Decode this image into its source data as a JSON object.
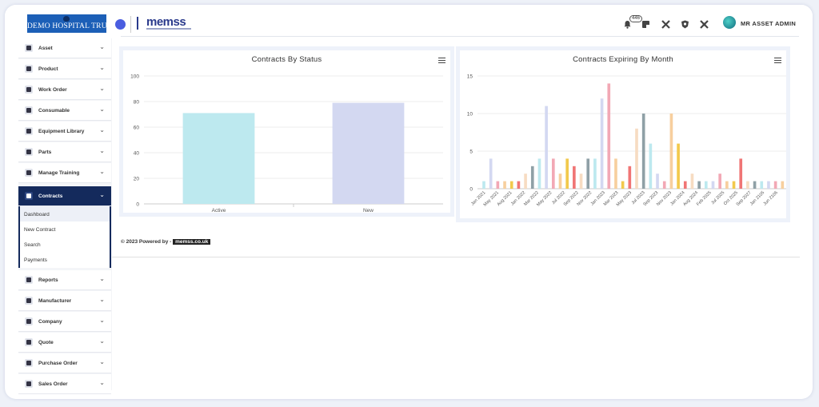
{
  "header": {
    "brand": "DEMO HOSPITAL TRUST",
    "logo_text": "memss",
    "notification_count": "446",
    "user_name": "MR ASSET ADMIN",
    "icons": [
      "bell-icon",
      "note-icon",
      "tools-icon",
      "shield-icon",
      "wrench-icon"
    ]
  },
  "sidebar": {
    "items": [
      {
        "label": "Asset",
        "icon": "asset-icon"
      },
      {
        "label": "Product",
        "icon": "product-icon"
      },
      {
        "label": "Work Order",
        "icon": "work-order-icon"
      },
      {
        "label": "Consumable",
        "icon": "consumable-icon"
      },
      {
        "label": "Equipment Library",
        "icon": "library-icon"
      },
      {
        "label": "Parts",
        "icon": "parts-icon"
      },
      {
        "label": "Manage Training",
        "icon": "training-icon"
      },
      {
        "label": "Contracts",
        "icon": "eye-icon",
        "active": true
      },
      {
        "label": "Reports",
        "icon": "reports-icon"
      },
      {
        "label": "Manufacturer",
        "icon": "factory-icon"
      },
      {
        "label": "Company",
        "icon": "company-icon"
      },
      {
        "label": "Quote",
        "icon": "quote-icon"
      },
      {
        "label": "Purchase Order",
        "icon": "purchase-icon"
      },
      {
        "label": "Sales Order",
        "icon": "sales-icon"
      }
    ],
    "contracts_sub": [
      "Dashboard",
      "New Contract",
      "Search",
      "Payments"
    ]
  },
  "footer": {
    "text": "© 2023 Powered by - ",
    "link": "memss.co.uk"
  },
  "chart_data": [
    {
      "type": "bar",
      "title": "Contracts By Status",
      "categories": [
        "Active",
        "New"
      ],
      "values": [
        71,
        79
      ],
      "colors": [
        "#bde9ef",
        "#d3d8f1"
      ],
      "ylim": [
        0,
        100
      ],
      "yticks": [
        0,
        20,
        40,
        60,
        80,
        100
      ]
    },
    {
      "type": "bar",
      "title": "Contracts Expiring By Month",
      "ylim": [
        0,
        15
      ],
      "yticks": [
        0,
        5,
        10,
        15
      ],
      "tick_labels": [
        "Jan 2021",
        "May 2021",
        "Aug 2021",
        "Jan 2022",
        "Mar 2022",
        "May 2022",
        "Jul 2022",
        "Sep 2022",
        "Nov 2022",
        "Jan 2023",
        "Mar 2023",
        "May 2023",
        "Jul 2023",
        "Sep 2023",
        "Nov 2023",
        "Jan 2024",
        "Aug 2024",
        "Feb 2025",
        "Jul 2025",
        "Oct 2025",
        "Sep 2027",
        "Jan 2105",
        "Jun 2106"
      ],
      "values": [
        1,
        4,
        1,
        1,
        1,
        1,
        2,
        3,
        4,
        11,
        4,
        2,
        4,
        3,
        2,
        4,
        4,
        12,
        14,
        4,
        1,
        3,
        8,
        10,
        6,
        2,
        1,
        10,
        6,
        1,
        2,
        1,
        1,
        1,
        2,
        1,
        1,
        4,
        1,
        1,
        1,
        1,
        1,
        1
      ],
      "colors": [
        "#bde9ef",
        "#d3d8f1",
        "#f2a8b5",
        "#f7cf9e",
        "#f2c94c",
        "#f07575",
        "#f7dcc2",
        "#8fa0a6",
        "#bde9ef",
        "#d3d8f1",
        "#f2a8b5",
        "#f7cf9e",
        "#f2c94c",
        "#f07575",
        "#f7dcc2",
        "#8fa0a6",
        "#bde9ef",
        "#d3d8f1",
        "#f2a8b5",
        "#f7cf9e",
        "#f2c94c",
        "#f07575",
        "#f7dcc2",
        "#8fa0a6",
        "#bde9ef",
        "#d3d8f1",
        "#f2a8b5",
        "#f7cf9e",
        "#f2c94c",
        "#f07575",
        "#f7dcc2",
        "#8fa0a6",
        "#bde9ef",
        "#d3d8f1",
        "#f2a8b5",
        "#f7cf9e",
        "#f2c94c",
        "#f07575",
        "#f7dcc2",
        "#8fa0a6",
        "#bde9ef",
        "#d3d8f1",
        "#f2a8b5",
        "#f7cf9e"
      ]
    }
  ]
}
